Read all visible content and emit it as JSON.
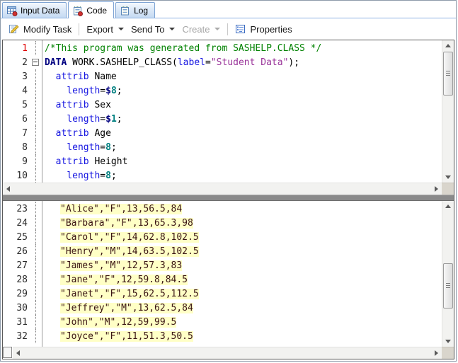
{
  "tabs": [
    {
      "label": "Input Data",
      "icon": "data-table-icon",
      "active": false,
      "modified_dot": true
    },
    {
      "label": "Code",
      "icon": "notepad-icon",
      "active": true,
      "modified_dot": true
    },
    {
      "label": "Log",
      "icon": "notepad-icon",
      "active": false,
      "modified_dot": false
    }
  ],
  "toolbar": {
    "modify_task": "Modify Task",
    "export": "Export",
    "send_to": "Send To",
    "create": "Create",
    "properties": "Properties"
  },
  "syntax_colors": {
    "comment": "#008200",
    "kw1": "#000080",
    "kw2": "#1414E0",
    "str": "#993399",
    "num": "#007F7F",
    "dollar": "#000080",
    "plain": "#000000"
  },
  "editor": {
    "line_number_color": "#2B2B2B",
    "current_line_number_color": "#E00000",
    "datalines_text_color": "#3A1414",
    "datalines_highlight_color": "#FFFFC6",
    "top_pane": {
      "lines": [
        {
          "num": "1",
          "num_red": true,
          "fold": "line",
          "segments": [
            {
              "c": "comment",
              "t": "/*This program was generated from SASHELP.CLASS */"
            }
          ]
        },
        {
          "num": "2",
          "num_red": false,
          "fold": "box",
          "segments": [
            {
              "c": "kw1",
              "t": "DATA"
            },
            {
              "c": "plain",
              "t": " WORK.SASHELP_CLASS("
            },
            {
              "c": "kw2",
              "t": "label"
            },
            {
              "c": "plain",
              "t": "="
            },
            {
              "c": "str",
              "t": "\"Student Data\""
            },
            {
              "c": "plain",
              "t": ");"
            }
          ]
        },
        {
          "num": "3",
          "num_red": false,
          "fold": "line",
          "segments": [
            {
              "c": "plain",
              "t": "  "
            },
            {
              "c": "kw2",
              "t": "attrib"
            },
            {
              "c": "plain",
              "t": " Name"
            }
          ]
        },
        {
          "num": "4",
          "num_red": false,
          "fold": "line",
          "segments": [
            {
              "c": "plain",
              "t": "    "
            },
            {
              "c": "kw2",
              "t": "length"
            },
            {
              "c": "plain",
              "t": "="
            },
            {
              "c": "dollar",
              "t": "$"
            },
            {
              "c": "num",
              "t": "8"
            },
            {
              "c": "plain",
              "t": ";"
            }
          ]
        },
        {
          "num": "5",
          "num_red": false,
          "fold": "line",
          "segments": [
            {
              "c": "plain",
              "t": "  "
            },
            {
              "c": "kw2",
              "t": "attrib"
            },
            {
              "c": "plain",
              "t": " Sex"
            }
          ]
        },
        {
          "num": "6",
          "num_red": false,
          "fold": "line",
          "segments": [
            {
              "c": "plain",
              "t": "    "
            },
            {
              "c": "kw2",
              "t": "length"
            },
            {
              "c": "plain",
              "t": "="
            },
            {
              "c": "dollar",
              "t": "$"
            },
            {
              "c": "num",
              "t": "1"
            },
            {
              "c": "plain",
              "t": ";"
            }
          ]
        },
        {
          "num": "7",
          "num_red": false,
          "fold": "line",
          "segments": [
            {
              "c": "plain",
              "t": "  "
            },
            {
              "c": "kw2",
              "t": "attrib"
            },
            {
              "c": "plain",
              "t": " Age"
            }
          ]
        },
        {
          "num": "8",
          "num_red": false,
          "fold": "line",
          "segments": [
            {
              "c": "plain",
              "t": "    "
            },
            {
              "c": "kw2",
              "t": "length"
            },
            {
              "c": "plain",
              "t": "="
            },
            {
              "c": "num",
              "t": "8"
            },
            {
              "c": "plain",
              "t": ";"
            }
          ]
        },
        {
          "num": "9",
          "num_red": false,
          "fold": "line",
          "segments": [
            {
              "c": "plain",
              "t": "  "
            },
            {
              "c": "kw2",
              "t": "attrib"
            },
            {
              "c": "plain",
              "t": " Height"
            }
          ]
        },
        {
          "num": "10",
          "num_red": false,
          "fold": "line",
          "segments": [
            {
              "c": "plain",
              "t": "    "
            },
            {
              "c": "kw2",
              "t": "length"
            },
            {
              "c": "plain",
              "t": "="
            },
            {
              "c": "num",
              "t": "8"
            },
            {
              "c": "plain",
              "t": ";"
            }
          ]
        }
      ]
    },
    "bottom_pane": {
      "lines": [
        {
          "num": "23",
          "text": "\"Alice\",\"F\",13,56.5,84"
        },
        {
          "num": "24",
          "text": "\"Barbara\",\"F\",13,65.3,98"
        },
        {
          "num": "25",
          "text": "\"Carol\",\"F\",14,62.8,102.5"
        },
        {
          "num": "26",
          "text": "\"Henry\",\"M\",14,63.5,102.5"
        },
        {
          "num": "27",
          "text": "\"James\",\"M\",12,57.3,83"
        },
        {
          "num": "28",
          "text": "\"Jane\",\"F\",12,59.8,84.5"
        },
        {
          "num": "29",
          "text": "\"Janet\",\"F\",15,62.5,112.5"
        },
        {
          "num": "30",
          "text": "\"Jeffrey\",\"M\",13,62.5,84"
        },
        {
          "num": "31",
          "text": "\"John\",\"M\",12,59,99.5"
        },
        {
          "num": "32",
          "text": "\"Joyce\",\"F\",11,51.3,50.5"
        }
      ]
    }
  }
}
